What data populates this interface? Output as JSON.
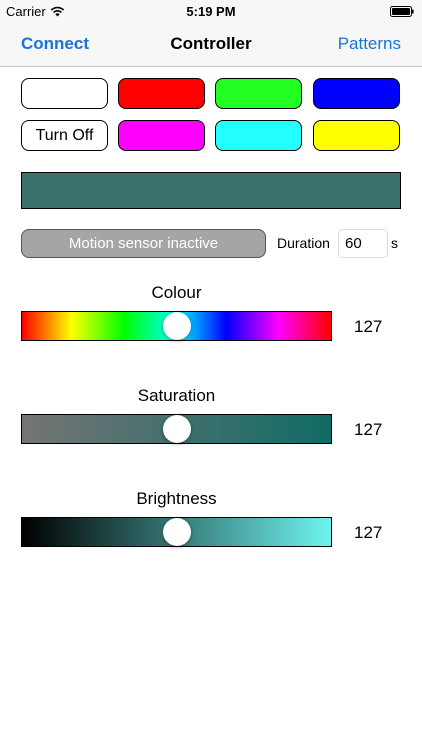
{
  "status_bar": {
    "carrier": "Carrier",
    "time": "5:19 PM"
  },
  "nav": {
    "left": "Connect",
    "title": "Controller",
    "right": "Patterns"
  },
  "swatches": [
    {
      "color": "#ffffff",
      "label": ""
    },
    {
      "color": "#ff0000",
      "label": ""
    },
    {
      "color": "#22ff22",
      "label": ""
    },
    {
      "color": "#0000ff",
      "label": ""
    },
    {
      "color": "#ffffff",
      "label": "Turn Off"
    },
    {
      "color": "#ff00ff",
      "label": ""
    },
    {
      "color": "#22ffff",
      "label": ""
    },
    {
      "color": "#ffff00",
      "label": ""
    }
  ],
  "preview_color": "#3a716a",
  "motion": {
    "label": "Motion sensor inactive",
    "duration_label": "Duration",
    "duration_value": "60",
    "unit": "s"
  },
  "sliders": {
    "colour": {
      "label": "Colour",
      "value": "127",
      "fraction": 0.5
    },
    "saturation": {
      "label": "Saturation",
      "value": "127",
      "fraction": 0.5
    },
    "brightness": {
      "label": "Brightness",
      "value": "127",
      "fraction": 0.5
    }
  },
  "colors": {
    "accent": "#1a73d8",
    "saturation_end": "#116b66",
    "brightness_end": "#6ef3ef"
  }
}
